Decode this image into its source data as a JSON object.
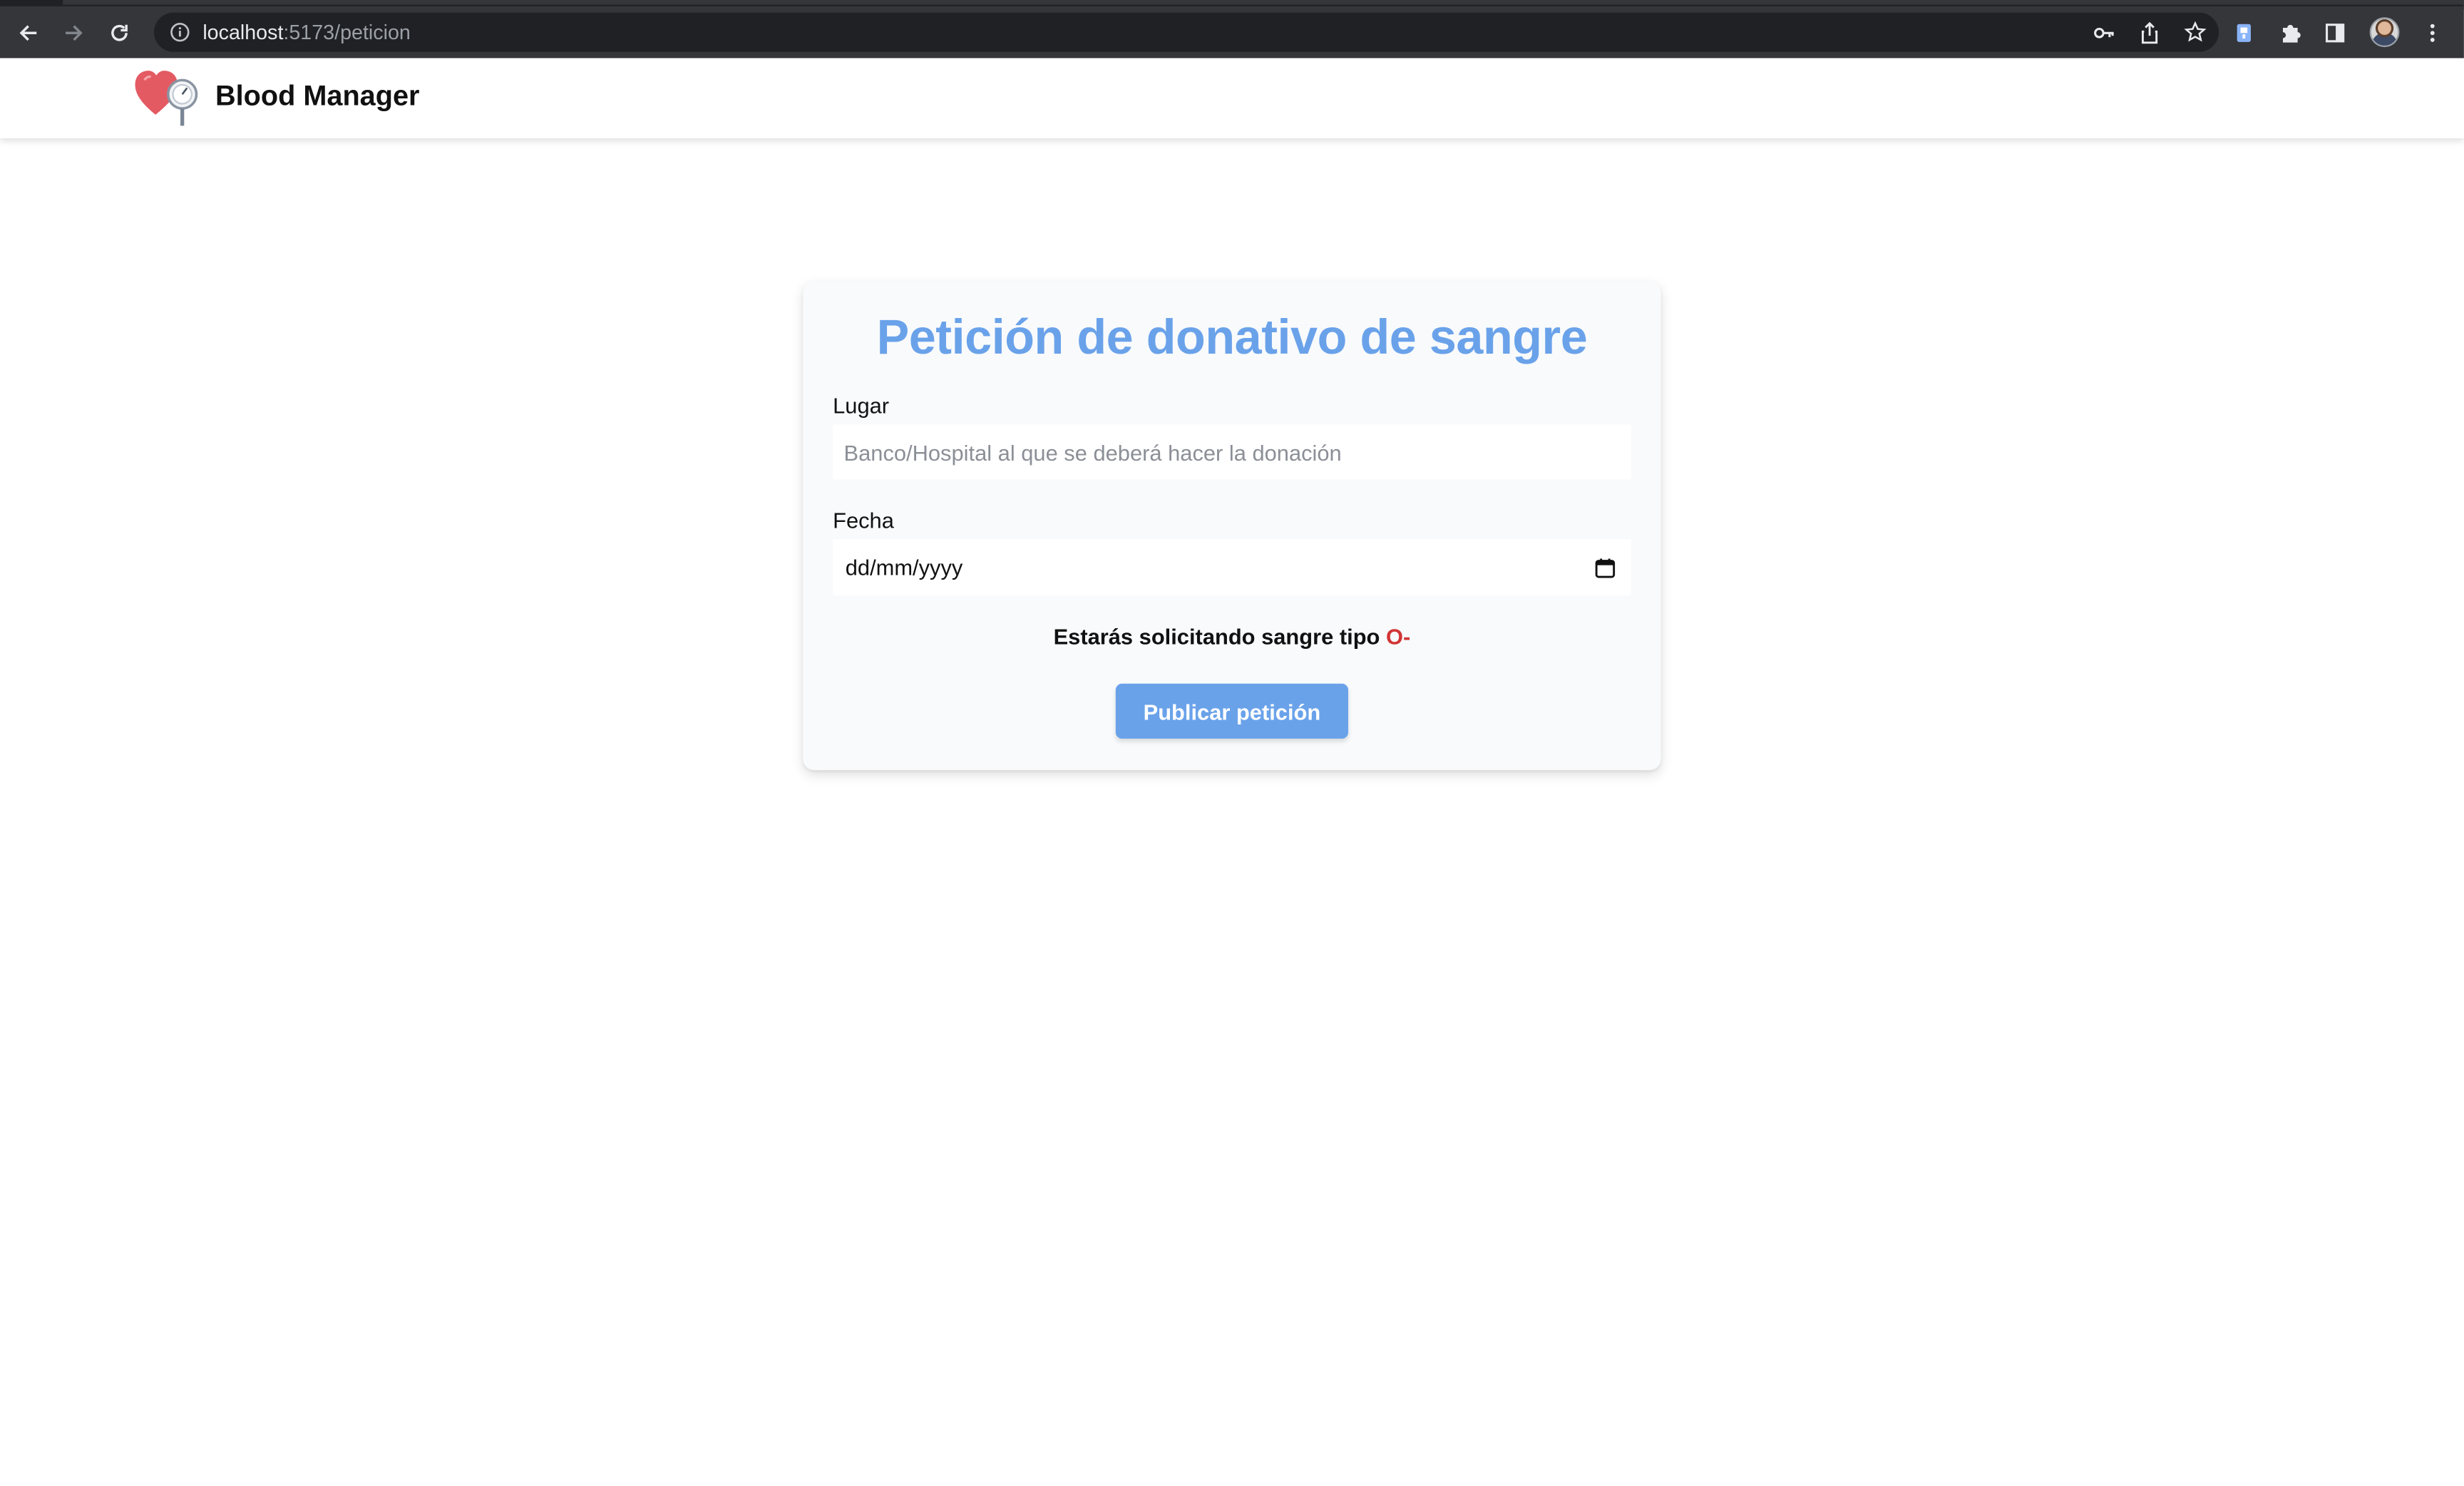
{
  "browser": {
    "url_host": "localhost",
    "url_path": ":5173/peticion"
  },
  "app": {
    "brand_name": "Blood Manager"
  },
  "form": {
    "title": "Petición de donativo de sangre",
    "place_label": "Lugar",
    "place_placeholder": "Banco/Hospital al que se deberá hacer la donación",
    "place_value": "",
    "date_label": "Fecha",
    "date_value": "dd/mm/yyyy",
    "summary_text": "Estarás solicitando sangre tipo",
    "blood_type": "O-",
    "submit_label": "Publicar petición"
  },
  "colors": {
    "accent": "#6aa2ea",
    "blood_type": "#d23434",
    "card_bg": "#f8fafc"
  }
}
